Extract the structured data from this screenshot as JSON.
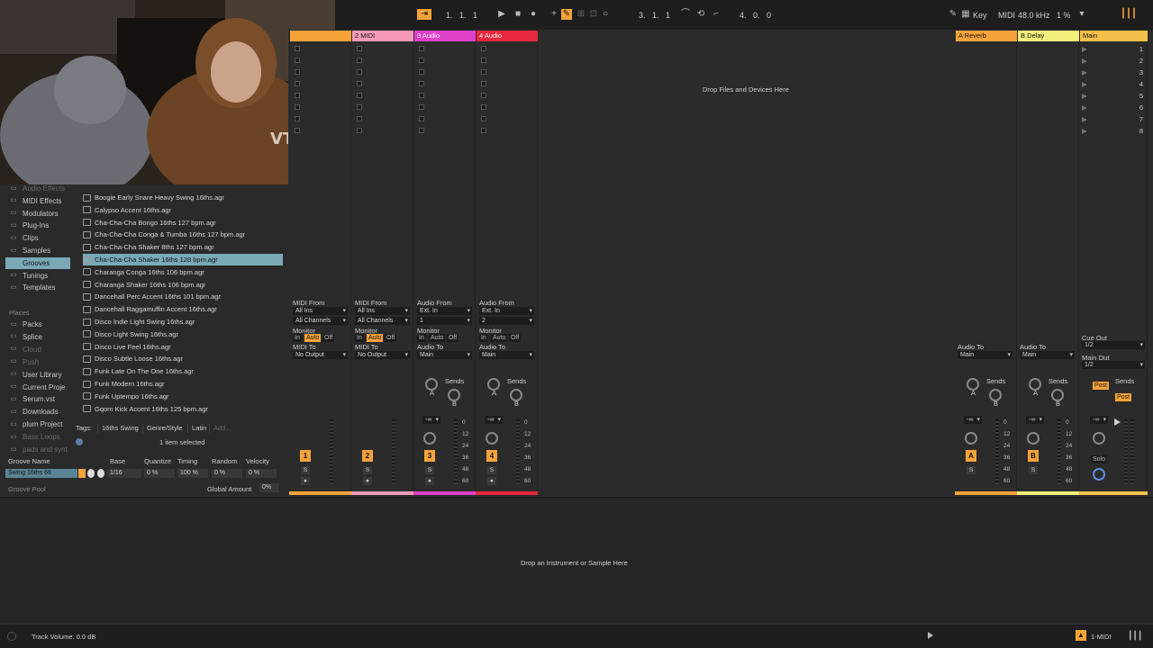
{
  "transport": {
    "position": "1.   1.   1",
    "loop_start": "3.   1.   1",
    "loop_length": "4.   0.   0",
    "key_label": "Key",
    "midi_label": "MIDI",
    "sample_rate": "48.0 kHz",
    "cpu": "1 %"
  },
  "browser": {
    "categories": [
      {
        "label": "Audio Effects",
        "icon": "audio-effects-icon",
        "dim": true
      },
      {
        "label": "MIDI Effects",
        "icon": "midi-effects-icon"
      },
      {
        "label": "Modulators",
        "icon": "modulators-icon"
      },
      {
        "label": "Plug-Ins",
        "icon": "plugins-icon"
      },
      {
        "label": "Clips",
        "icon": "clips-icon"
      },
      {
        "label": "Samples",
        "icon": "samples-icon"
      },
      {
        "label": "Grooves",
        "icon": "grooves-icon",
        "selected": true
      },
      {
        "label": "Tunings",
        "icon": "tunings-icon"
      },
      {
        "label": "Templates",
        "icon": "templates-icon"
      }
    ],
    "places_header": "Places",
    "places": [
      {
        "label": "Packs"
      },
      {
        "label": "Splice"
      },
      {
        "label": "Cloud",
        "dim": true
      },
      {
        "label": "Push",
        "dim": true
      },
      {
        "label": "User Library"
      },
      {
        "label": "Current Proje"
      },
      {
        "label": "Serum.vst"
      },
      {
        "label": "Downloads"
      },
      {
        "label": "plum Project"
      },
      {
        "label": "Bass Loops",
        "dim": true
      },
      {
        "label": "pads and synt",
        "dim": true
      }
    ],
    "files": [
      "Boogie Early Snare Heavy Swing 16ths.agr",
      "Calypso Accent 16ths.agr",
      "Cha-Cha-Cha Bongo 16ths 127 bpm.agr",
      "Cha-Cha-Cha Conga & Tumba 16ths 127 bpm.agr",
      "Cha-Cha-Cha Shaker 8ths 127 bpm.agr",
      "Cha-Cha-Cha Shaker 16ths 128 bpm.agr",
      "Charanga Conga 16ths 106 bpm.agr",
      "Charanga Shaker 16ths 106 bpm.agr",
      "Dancehall Perc Accent 16ths 101 bpm.agr",
      "Dancehall Raggamuffin Accent 16ths.agr",
      "Disco Indie Light Swing 16ths.agr",
      "Disco Light Swing 16ths.agr",
      "Disco Live Feel 16ths.agr",
      "Disco Subtle Loose 16ths.agr",
      "Funk Late On The One 16ths.agr",
      "Funk Modern 16ths.agr",
      "Funk Uptempo 16ths.agr",
      "Gqom Kick Accent 16ths 125 bpm.agr"
    ],
    "selected_file_index": 5,
    "tags_label": "Tags:",
    "tags": [
      "16ths Swing",
      "Genre/Style",
      "Latin",
      "Add..."
    ],
    "selection_status": "1 item selected"
  },
  "groove_pool": {
    "headers": [
      "Groove Name",
      "Base",
      "Quantize",
      "Timing",
      "Random",
      "Velocity"
    ],
    "row": {
      "name": "Swing 16ths 66",
      "base": "1/16",
      "quantize": "0 %",
      "timing": "100 %",
      "random": "0 %",
      "velocity": "0 %"
    },
    "title": "Groove Pool",
    "global_amount_label": "Global Amount",
    "global_amount": "0%"
  },
  "tracks": [
    {
      "name": "",
      "color": "#f6a33a",
      "num": "1",
      "io_from": "MIDI From",
      "from": "All Ins",
      "channel": "All Channels",
      "to_label": "MIDI To",
      "to": "No Output"
    },
    {
      "name": "2 MIDI",
      "color": "#f49ab8",
      "num": "2",
      "io_from": "MIDI From",
      "from": "All Ins",
      "channel": "All Channels",
      "to_label": "MIDI To",
      "to": "No Output"
    },
    {
      "name": "3 Audio",
      "color": "#e040c8",
      "num": "3",
      "io_from": "Audio From",
      "from": "Ext. In",
      "channel": "1",
      "to_label": "Audio To",
      "to": "Main"
    },
    {
      "name": "4 Audio",
      "color": "#e8283c",
      "num": "4",
      "io_from": "Audio From",
      "from": "Ext. In",
      "channel": "2",
      "to_label": "Audio To",
      "to": "Main"
    }
  ],
  "monitor": {
    "label": "Monitor",
    "in": "In",
    "auto": "Auto",
    "off": "Off"
  },
  "sends_label": "Sends",
  "send_a": "A",
  "send_b": "B",
  "volume": "-∞",
  "db_scale": [
    "0",
    "12",
    "24",
    "36",
    "48",
    "60"
  ],
  "drop_files": "Drop Files and Devices Here",
  "returns": [
    {
      "name": "A Reverb",
      "color": "#f6a33a",
      "letter": "A",
      "to_label": "Audio To",
      "to": "Main"
    },
    {
      "name": "B Delay",
      "color": "#f1f07a",
      "letter": "B",
      "to_label": "Audio To",
      "to": "Main"
    }
  ],
  "main": {
    "name": "Main",
    "color": "#f4c04a",
    "cue_label": "Cue Out",
    "cue": "1/2",
    "out_label": "Main Out",
    "out": "1/2",
    "post": "Post",
    "solo": "Solo",
    "scenes": [
      "1",
      "2",
      "3",
      "4",
      "5",
      "6",
      "7",
      "8"
    ]
  },
  "detail": {
    "drop_instrument": "Drop an Instrument or Sample Here"
  },
  "status": {
    "track_volume": "Track Volume: 0.0 dB",
    "selected_track": "1-MIDI"
  }
}
